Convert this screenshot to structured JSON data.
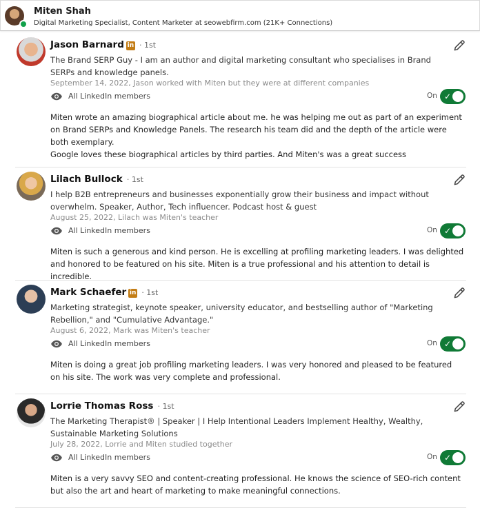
{
  "profile": {
    "name": "Miten Shah",
    "headline": "Digital Marketing Specialist, Content Marketer at seowebfirm.com (21K+ Connections)"
  },
  "visibility_label": "All LinkedIn members",
  "toggle_label": "On",
  "degree": "· 1st",
  "colors": {
    "toggle_on": "#107a36",
    "linkedin_badge": "#c37d16"
  },
  "recommendations": [
    {
      "name": "Jason Barnard",
      "badge": "in",
      "title": "The Brand SERP Guy - I am an author and digital marketing consultant who specialises in Brand SERPs and knowledge panels.",
      "date": "September 14, 2022, Jason worked with Miten but they were at different companies",
      "text": "Miten wrote an amazing biographical article about me. he was helping me out as part of an experiment on Brand SERPs and Knowledge Panels. The research his team did and the depth of the article were both exemplary.",
      "text2": "Google loves these biographical articles by third parties. And Miten's was a great success"
    },
    {
      "name": "Lilach Bullock",
      "badge": "",
      "title": "I help B2B entrepreneurs and businesses exponentially grow their business and impact without overwhelm. Speaker, Author, Tech influencer. Podcast host & guest",
      "date": "August 25, 2022, Lilach was Miten's teacher",
      "text": "Miten is such a generous and kind person. He is excelling at profiling marketing leaders. I was delighted and honored to be featured on his site. Miten is a true professional and his attention to detail is incredible."
    },
    {
      "name": "Mark Schaefer",
      "badge": "in",
      "title": "Marketing strategist, keynote speaker, university educator, and bestselling author of \"Marketing Rebellion,\" and \"Cumulative Advantage.\"",
      "date": "August 6, 2022, Mark was Miten's teacher",
      "text": "Miten is doing a great job profiling marketing leaders. I was very honored and pleased to be featured on his site. The work was very complete and professional."
    },
    {
      "name": "Lorrie Thomas Ross",
      "badge": "",
      "title": "The Marketing Therapist® | Speaker | I Help Intentional Leaders Implement Healthy, Wealthy, Sustainable Marketing Solutions",
      "date": "July 28, 2022, Lorrie and Miten studied together",
      "text": "Miten is a very savvy SEO and content-creating professional. He knows the science of SEO-rich content but also the art and heart of marketing to make meaningful connections."
    }
  ]
}
